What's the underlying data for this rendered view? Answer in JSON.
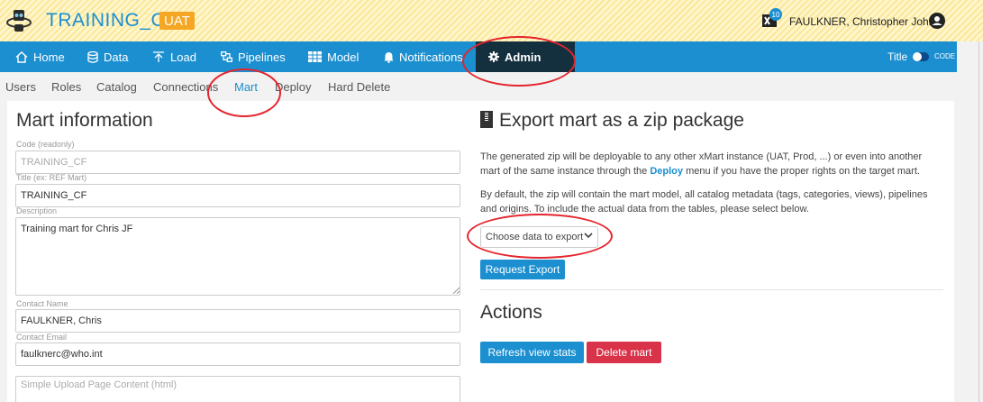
{
  "header": {
    "app_title": "TRAINING_CF",
    "env_badge": "UAT",
    "notification_count": "10",
    "user_name": "FAULKNER, Christopher John"
  },
  "nav": {
    "items": [
      {
        "label": "Home",
        "icon": "home-icon"
      },
      {
        "label": "Data",
        "icon": "database-icon"
      },
      {
        "label": "Load",
        "icon": "upload-icon"
      },
      {
        "label": "Pipelines",
        "icon": "pipelines-icon"
      },
      {
        "label": "Model",
        "icon": "model-icon"
      },
      {
        "label": "Notifications",
        "icon": "bell-icon"
      },
      {
        "label": "Admin",
        "icon": "gear-icon"
      }
    ],
    "active": "Admin",
    "title_toggle_label": "Title",
    "code_label": "CODE"
  },
  "subnav": {
    "items": [
      "Users",
      "Roles",
      "Catalog",
      "Connections",
      "Mart",
      "Deploy",
      "Hard Delete"
    ],
    "active": "Mart"
  },
  "mart_info": {
    "heading": "Mart information",
    "code_label": "Code (readonly)",
    "code_value": "TRAINING_CF",
    "title_label": "Title (ex: REF Mart)",
    "title_value": "TRAINING_CF",
    "description_label": "Description",
    "description_value": "Training mart for Chris JF",
    "contact_name_label": "Contact Name",
    "contact_name_value": "FAULKNER, Chris",
    "contact_email_label": "Contact Email",
    "contact_email_value": "faulknerc@who.int",
    "upload_page_placeholder": "Simple Upload Page Content (html)"
  },
  "export": {
    "heading": "Export mart as a zip package",
    "para1_a": "The generated zip will be deployable to any other xMart instance (UAT, Prod, ...) or even into another mart of the same instance through the ",
    "para1_link": "Deploy",
    "para1_b": " menu if you have the proper rights on the target mart.",
    "para2": "By default, the zip will contain the mart model, all catalog metadata (tags, categories, views), pipelines and origins. To include the actual data from the tables, please select below.",
    "select_value": "Choose data to export",
    "request_button": "Request Export"
  },
  "actions": {
    "heading": "Actions",
    "refresh_button": "Refresh view stats",
    "delete_button": "Delete mart"
  },
  "colors": {
    "brand_blue": "#1b8fd0",
    "uat_orange": "#f5a623",
    "nav_active": "#14303f",
    "danger": "#d9334a",
    "annotation_red": "#e4252d"
  }
}
